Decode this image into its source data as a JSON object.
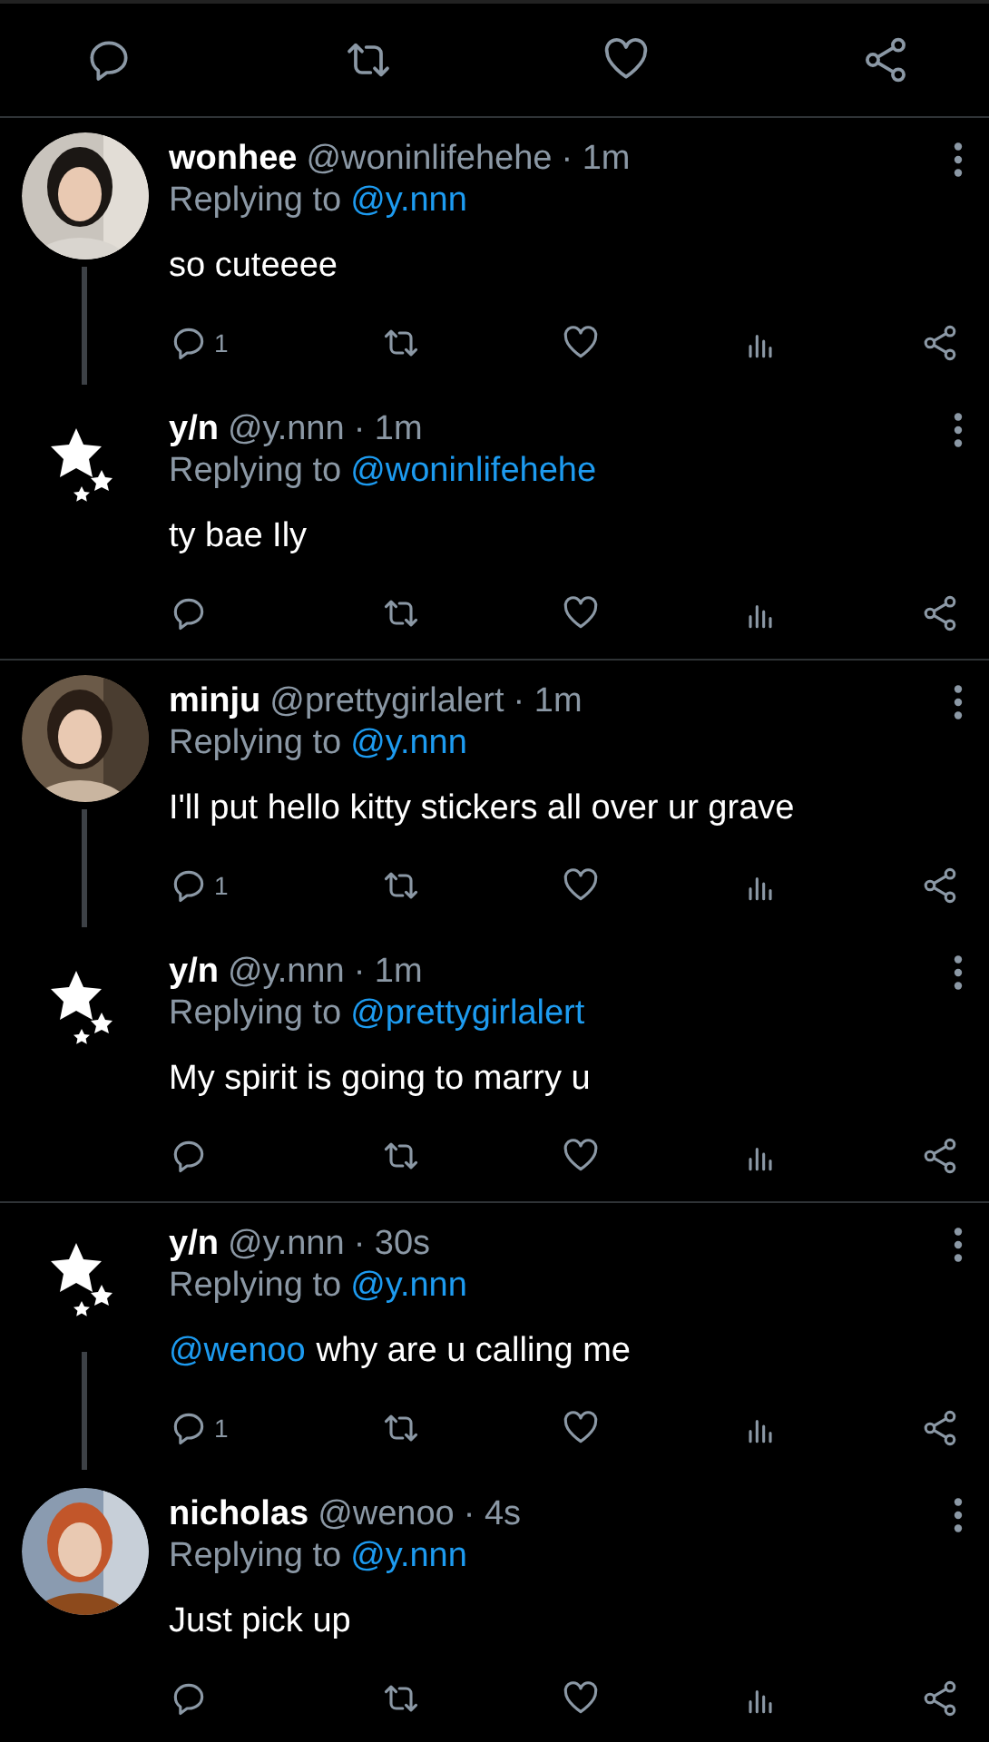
{
  "threads": [
    {
      "tweets": [
        {
          "name": "wonhee",
          "handle": "@woninlifehehe",
          "time": "· 1m",
          "replying_label": "Replying to",
          "replying_to": "@y.nnn",
          "text": "so cuteeee",
          "reply_count": "1"
        },
        {
          "avatar": {
            "kind": "stars"
          },
          "name": "y/n",
          "handle": "@y.nnn",
          "time": "· 1m",
          "replying_label": "Replying to",
          "replying_to": "@woninlifehehe",
          "text": "ty bae Ily"
        }
      ]
    },
    {
      "tweets": [
        {
          "name": "minju",
          "handle": "@prettygirlalert",
          "time": "· 1m",
          "replying_label": "Replying to",
          "replying_to": "@y.nnn",
          "text": "I'll put hello kitty stickers all over ur grave",
          "reply_count": "1"
        },
        {
          "avatar": {
            "kind": "stars"
          },
          "name": "y/n",
          "handle": "@y.nnn",
          "time": "· 1m",
          "replying_label": "Replying to",
          "replying_to": "@prettygirlalert",
          "text": "My spirit is going to marry u"
        }
      ]
    },
    {
      "tweets": [
        {
          "avatar": {
            "kind": "stars"
          },
          "name": "y/n",
          "handle": "@y.nnn",
          "time": "· 30s",
          "replying_label": "Replying to",
          "replying_to": "@y.nnn",
          "mention": "@wenoo",
          "text": "why are u calling me",
          "reply_count": "1"
        },
        {
          "name": "nicholas",
          "handle": "@wenoo",
          "time": "· 4s",
          "replying_label": "Replying to",
          "replying_to": "@y.nnn",
          "text": "Just pick up"
        }
      ]
    }
  ]
}
